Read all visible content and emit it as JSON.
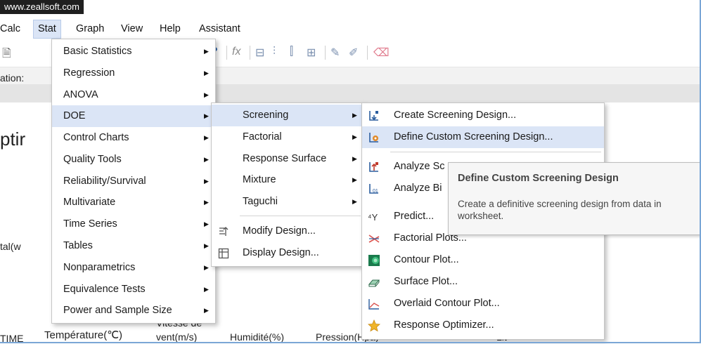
{
  "watermark": "www.zeallsoft.com",
  "menubar": [
    "Calc",
    "Stat",
    "Graph",
    "View",
    "Help",
    "Assistant"
  ],
  "background": {
    "label_left_1": "ation:",
    "label_left_2": "ptir",
    "label_left_3": "tal(w",
    "col_time": "TIME",
    "col_temp": "Température(℃)",
    "col_vitesse_1": "Vitesse de",
    "col_vitesse_2": "vent(m/s)",
    "col_humid": "Humidité(%)",
    "col_pression": "Pression(Hpa)",
    "col_last": "Lit"
  },
  "stat_menu": [
    "Basic Statistics",
    "Regression",
    "ANOVA",
    "DOE",
    "Control Charts",
    "Quality Tools",
    "Reliability/Survival",
    "Multivariate",
    "Time Series",
    "Tables",
    "Nonparametrics",
    "Equivalence Tests",
    "Power and Sample Size"
  ],
  "doe_menu": {
    "submenus": [
      "Screening",
      "Factorial",
      "Response Surface",
      "Mixture",
      "Taguchi"
    ],
    "actions": [
      "Modify Design...",
      "Display Design..."
    ]
  },
  "screening_menu": [
    "Create Screening Design...",
    "Define Custom Screening Design...",
    "Analyze Screening Design...",
    "Analyze Binary Response...",
    "Predict...",
    "Factorial Plots...",
    "Contour Plot...",
    "Surface Plot...",
    "Overlaid Contour Plot...",
    "Response Optimizer..."
  ],
  "screening_visible_labels": {
    "analyze_sc": "Analyze Sc",
    "analyze_bi": "Analyze Bi"
  },
  "tooltip": {
    "title": "Define Custom Screening Design",
    "body": "Create a definitive screening design from data in worksheet."
  },
  "colors": {
    "highlight": "#dbe5f6",
    "menu_border": "#c6c6c6",
    "tooltip_bg": "#f6f6f6"
  }
}
